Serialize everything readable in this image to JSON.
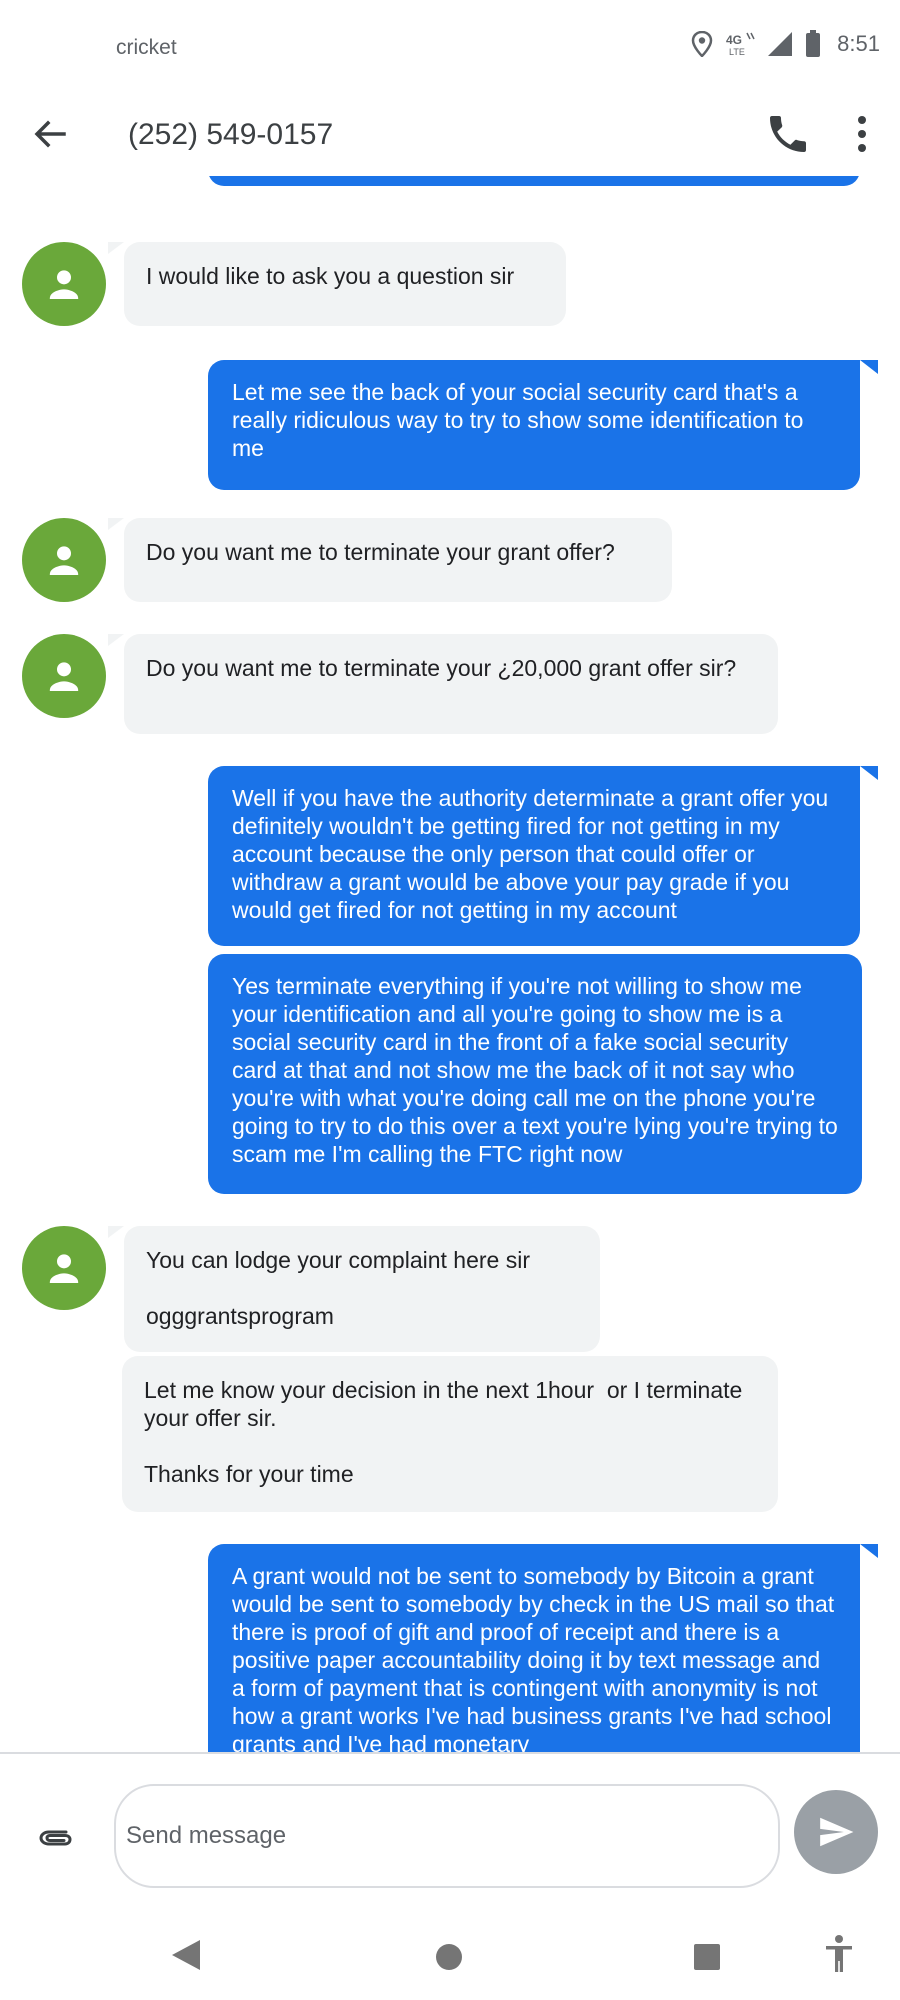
{
  "status_bar": {
    "carrier": "cricket",
    "time": "8:51",
    "network": "4G LTE",
    "icons": [
      "location-icon",
      "lte-icon",
      "signal-icon",
      "battery-icon"
    ]
  },
  "app_bar": {
    "title": "(252) 549-0157",
    "icons": [
      "back-arrow-icon",
      "phone-icon",
      "more-vert-icon"
    ]
  },
  "messages": [
    {
      "direction": "incoming",
      "text": "I would like to ask you a question sir"
    },
    {
      "direction": "outgoing",
      "text": "Let me see the back of your social security card that's a really ridiculous way to try to show some identification to me"
    },
    {
      "direction": "incoming",
      "text": "Do you want me to terminate your grant offer?"
    },
    {
      "direction": "incoming",
      "text": "Do you want me to terminate your ¿20,000 grant offer sir?"
    },
    {
      "direction": "outgoing",
      "text": "Well if you have the authority determinate a grant offer you definitely wouldn't be getting fired for not getting in my account because the only person that could offer or withdraw a grant would be above your pay grade if you would get fired for not getting in my account"
    },
    {
      "direction": "outgoing",
      "text": "Yes terminate everything if you're not willing to show me your identification and all you're going to show me is a social security card in the front of a fake social security card at that and not show me the back of it not say who you're with what you're doing call me on the phone you're going to try to do this over a text you're lying you're trying to scam me I'm calling the FTC right now"
    },
    {
      "direction": "incoming",
      "text": "You can lodge your complaint here sir\n\nogggrantsprogram"
    },
    {
      "direction": "incoming",
      "text": "Let me know your decision in the next 1hour  or I terminate your offer sir.\n\nThanks for your time"
    },
    {
      "direction": "outgoing",
      "text": "A grant would not be sent to somebody by Bitcoin a grant would be sent to somebody by check in the US mail so that there is proof of gift and proof of receipt and there is a positive paper accountability doing it by text message and a form of payment that is contingent with anonymity is not how a grant works I've had business grants I've had school grants and I've had monetary"
    }
  ],
  "composer": {
    "placeholder": "Send message",
    "icons": [
      "attach-icon",
      "send-icon"
    ]
  },
  "nav_bar": {
    "icons": [
      "nav-back-icon",
      "nav-home-icon",
      "nav-recents-icon",
      "accessibility-icon"
    ]
  },
  "colors": {
    "outgoing_bubble": "#1a73e8",
    "incoming_bubble": "#f1f3f4",
    "avatar": "#6aa83a",
    "send_button": "#9aa0a6"
  }
}
